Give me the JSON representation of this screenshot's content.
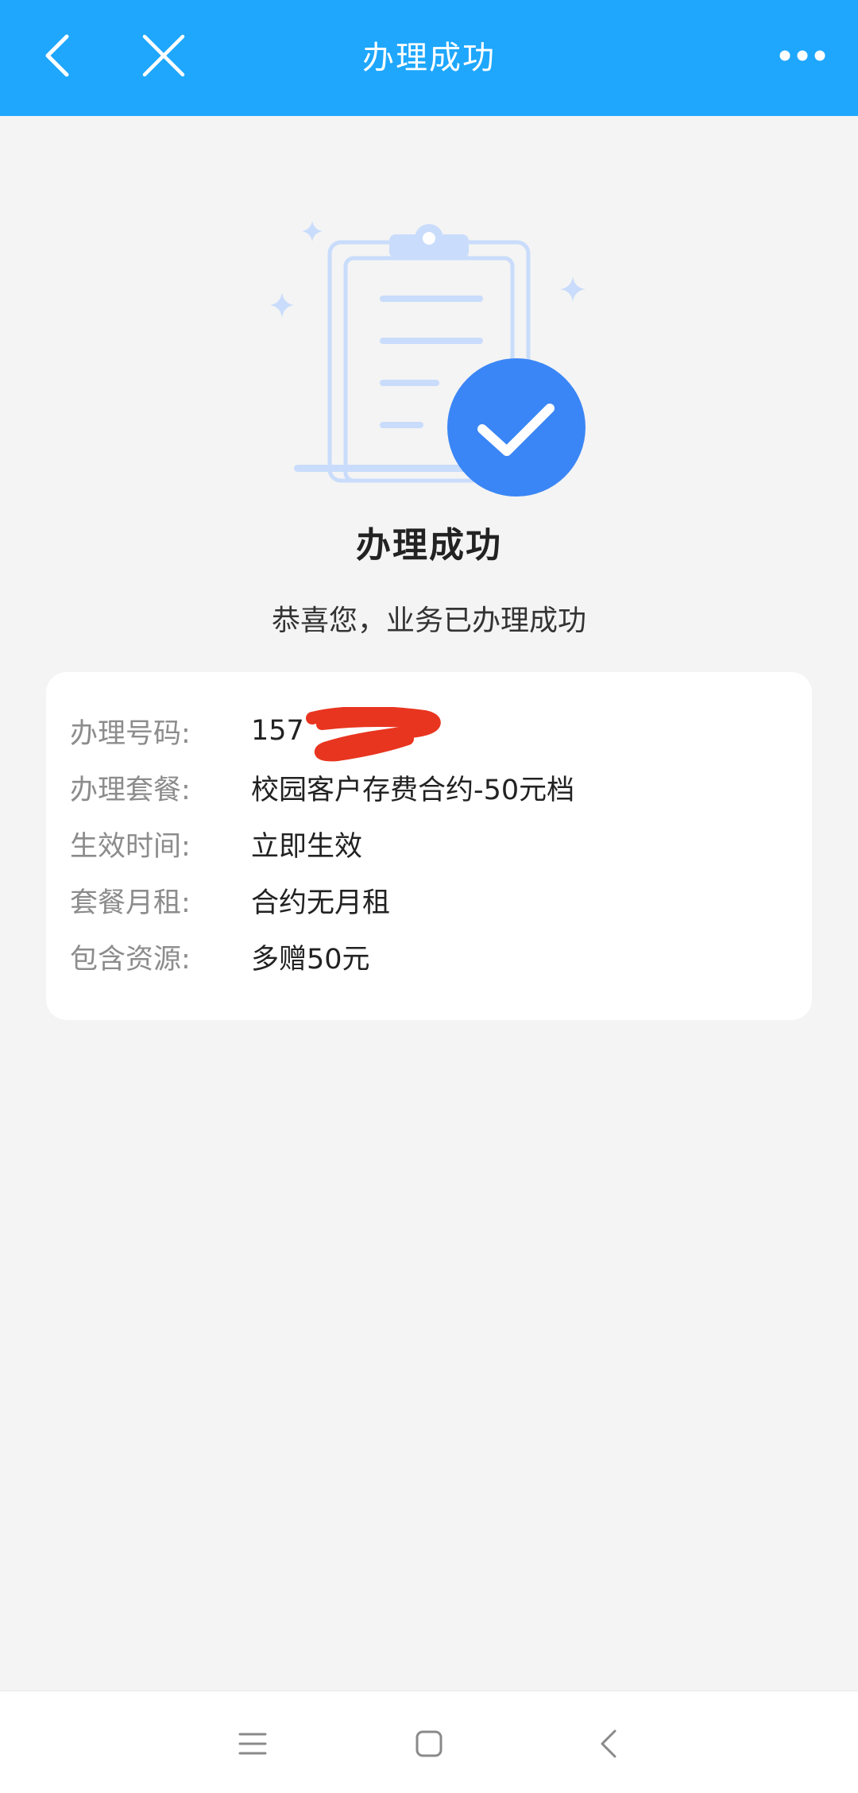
{
  "header": {
    "title": "办理成功",
    "back_icon": "chevron-left-icon",
    "close_icon": "close-icon",
    "more_icon": "more-dots-icon"
  },
  "result": {
    "illustration_icon": "clipboard-check-icon",
    "title": "办理成功",
    "subtitle": "恭喜您，业务已办理成功"
  },
  "details": {
    "rows": [
      {
        "label": "办理号码:",
        "value": "157"
      },
      {
        "label": "办理套餐:",
        "value": "校园客户存费合约-50元档"
      },
      {
        "label": "生效时间:",
        "value": "立即生效"
      },
      {
        "label": "套餐月租:",
        "value": "合约无月租"
      },
      {
        "label": "包含资源:",
        "value": "多赠50元"
      }
    ]
  },
  "system_nav": {
    "menu_icon": "menu-icon",
    "home_icon": "home-square-icon",
    "back_icon": "back-chevron-icon"
  },
  "colors": {
    "header_bg": "#1ea7fd",
    "page_bg": "#f4f4f4",
    "check_circle": "#3b86f6",
    "illustration_light": "#c9dcfb",
    "redaction": "#e8351f"
  }
}
